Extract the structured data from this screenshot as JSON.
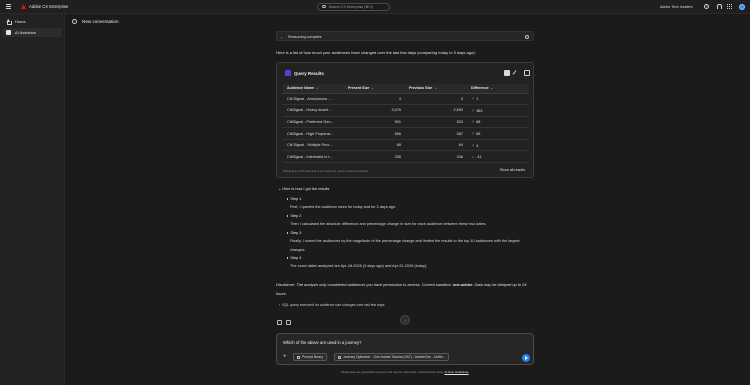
{
  "app": {
    "brand": "Adobe CX Enterprise",
    "org": "Adobe Tech Insiders"
  },
  "search": {
    "placeholder": "Search CX Enterprise (⌘+/)"
  },
  "sidebar": {
    "items": [
      {
        "label": "Home"
      },
      {
        "label": "AI Assistant"
      }
    ]
  },
  "conversation": {
    "title": "New conversation"
  },
  "reasoning": {
    "label": "Reasoning complete"
  },
  "intro": "Here is a list of how much your audiences have changed over the last few days (comparing today to 3 days ago):",
  "query_results": {
    "title": "Query Results",
    "columns": [
      "Audience Name",
      "Present Size",
      "Previous Size",
      "Difference"
    ],
    "rows": [
      {
        "name": "Citi Signal - Anonymous ...",
        "present": "4",
        "previous": "3",
        "trend": "up",
        "difference": "1"
      },
      {
        "name": "CitiSignal - Heavy downl...",
        "present": "3,076",
        "previous": "2,693",
        "trend": "up",
        "difference": "383"
      },
      {
        "name": "CitiSignal - Preferred Gen...",
        "present": "591",
        "previous": "523",
        "trend": "up",
        "difference": "68"
      },
      {
        "name": "CitiSignal - High Propensi...",
        "present": "656",
        "previous": "587",
        "trend": "up",
        "difference": "69"
      },
      {
        "name": "Citi Signal - Multiple Purc...",
        "present": "68",
        "previous": "64",
        "trend": "up",
        "difference": "4"
      },
      {
        "name": "CitiSignal - Interested in t...",
        "present": "235",
        "previous": "246",
        "trend": "down",
        "difference": "-11"
      }
    ],
    "footer_note": "Showing 6 of 10 rows and 4 of 4 columns, some content truncated",
    "show_all": "Show all results"
  },
  "how": {
    "toggle": "Here is how I got the results",
    "steps": [
      {
        "title": "Step 1",
        "desc": "First, I queried the audience sizes for today and for 3 days ago."
      },
      {
        "title": "Step 2",
        "desc": "Then I calculated the absolute difference and percentage change in size for each audience between these two dates."
      },
      {
        "title": "Step 3",
        "desc": "Finally, I sorted the audiences by the magnitude of the percentage change and limited the results to the top 10 audiences with the largest changes."
      },
      {
        "title": "Step 4",
        "desc": "The exact dates analyzed are Apr-18-2026 (3 days ago) and Apr-21-2026 (today)."
      }
    ]
  },
  "disclaimer": {
    "text_a": "Disclaimer: The analysis only considered audiences you have permission to access. Current sandbox: ",
    "sandbox": "one-adobe",
    "text_b": ". Data may be delayed up to 24 hours."
  },
  "sql_toggle": "SQL query executed for audience size changes over last few days",
  "composer": {
    "prompt": "Which of the above are used in a journey?",
    "chip_library": "Prompt library",
    "chip_sandbox": "Journey Optimizer - One Adobe Tutorial (VA7) - AdobeOne - Unifie..."
  },
  "footer": {
    "text": "Responses are generated using AI, and may be inaccurate. Check before using.",
    "link": "AI User Guidelines"
  }
}
